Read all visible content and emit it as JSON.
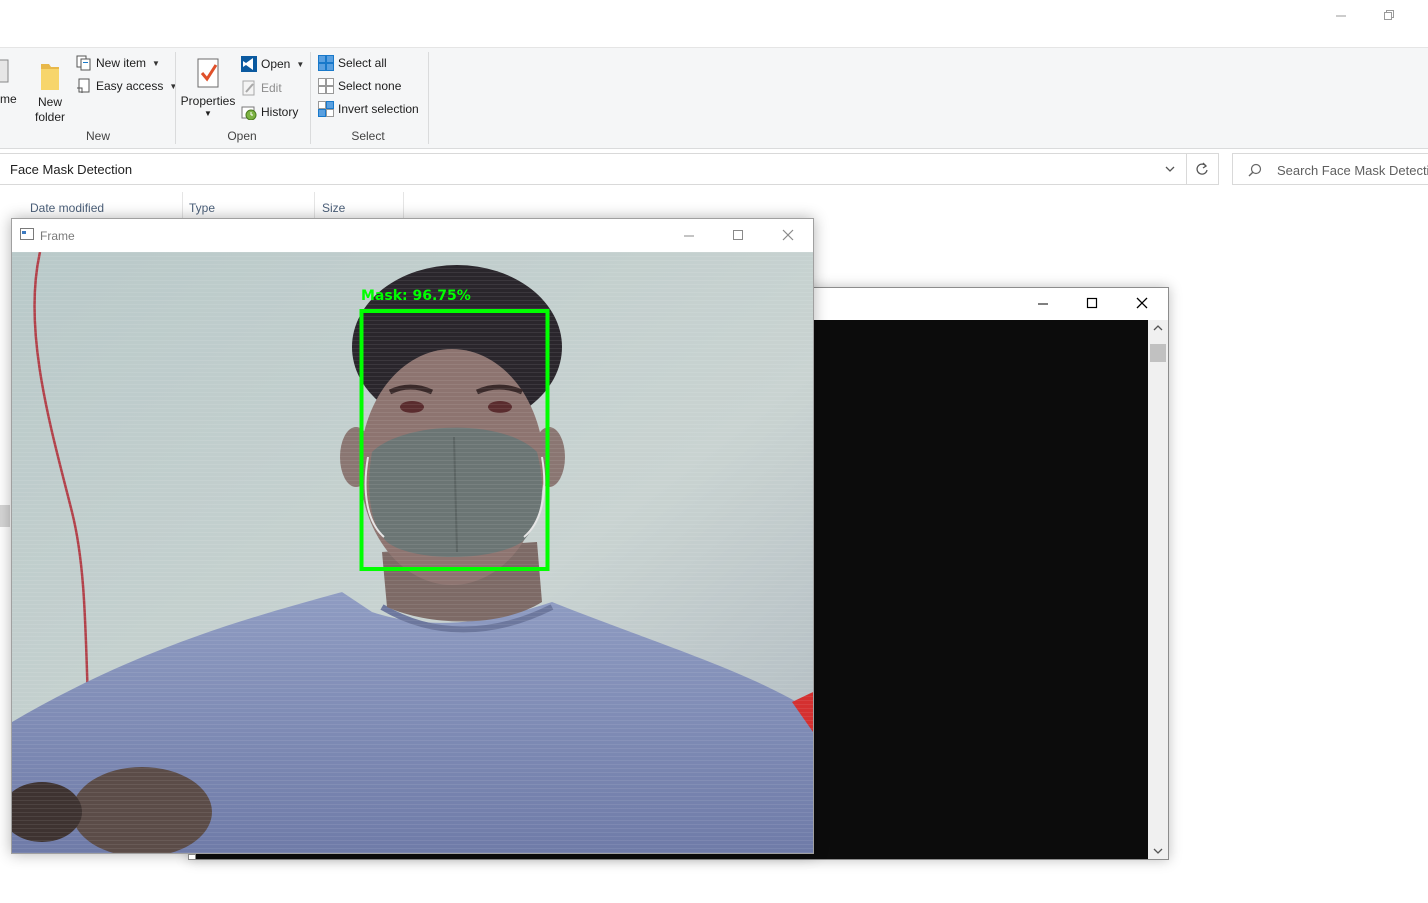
{
  "window_controls": {
    "minimize": "—",
    "restore": "❐"
  },
  "ribbon": {
    "left_partial_label": "me",
    "new_group": {
      "label": "New",
      "new_folder": [
        "New",
        "folder"
      ],
      "new_item": "New item",
      "easy_access": "Easy access"
    },
    "open_group": {
      "label": "Open",
      "properties": "Properties",
      "open": "Open",
      "edit": "Edit",
      "history": "History"
    },
    "select_group": {
      "label": "Select",
      "select_all": "Select all",
      "select_none": "Select none",
      "invert_selection": "Invert selection"
    }
  },
  "address_bar": {
    "path": "Face Mask Detection"
  },
  "search": {
    "placeholder": "Search Face Mask Detection"
  },
  "columns": [
    "Date modified",
    "Type",
    "Size"
  ],
  "frame_window": {
    "title": "Frame",
    "detection": {
      "label": "Mask: 96.75%",
      "color": "#00ff00"
    }
  },
  "console_window": {
    "title": ""
  },
  "colors": {
    "accent": "#1979ca",
    "detection_box": "#00ff00",
    "console_bg": "#0c0c0c"
  }
}
